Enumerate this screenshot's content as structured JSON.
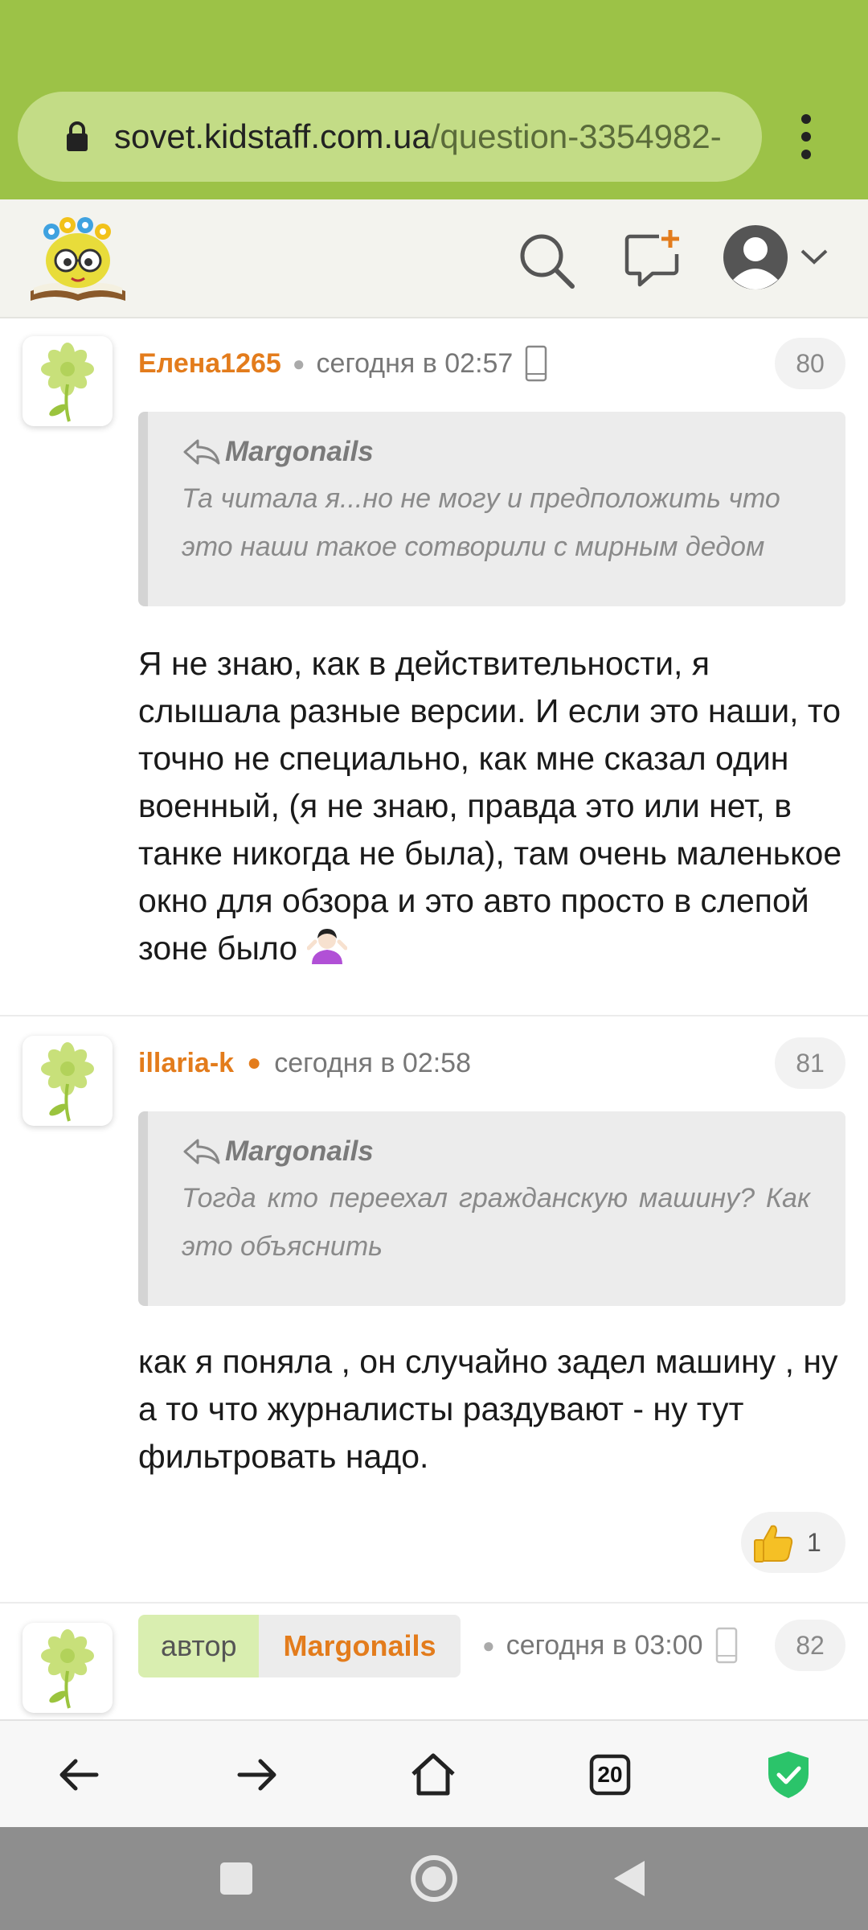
{
  "browser": {
    "url_domain": "sovet.kidstaff.com.ua",
    "url_path": "/question-3354982-"
  },
  "colors": {
    "toolbar": "#9cc247",
    "username": "#e37c1c",
    "shield": "#2bc46a"
  },
  "posts": [
    {
      "username": "Елена1265",
      "timestamp": "сегодня в 02:57",
      "number": "80",
      "quote_author": "Margonails",
      "quote_text": "Та читала я...но не могу и предположить что это наши такое сотворили с мирным дедом",
      "body": "Я не знаю, как в действительности, я слышала разные версии. И если это наши, то точно не специально, как мне сказал один военный, (я не знаю, правда это или нет, в танке никогда не была), там очень маленькое окно для обзора и это авто просто в слепой зоне было"
    },
    {
      "username": "illaria-k",
      "timestamp": "сегодня в 02:58",
      "number": "81",
      "quote_author": "Margonails",
      "quote_text": "Тогда кто переехал гражданскую машину? Как это объяснить",
      "body": "как я поняла , он случайно задел машину , ну а то что журналисты раздувают - ну тут фильтровать надо.",
      "likes": "1"
    },
    {
      "author_label": "автор",
      "username": "Margonails",
      "timestamp": "сегодня в 03:00",
      "number": "82"
    }
  ],
  "bottom_nav": {
    "tabs_count": "20"
  }
}
